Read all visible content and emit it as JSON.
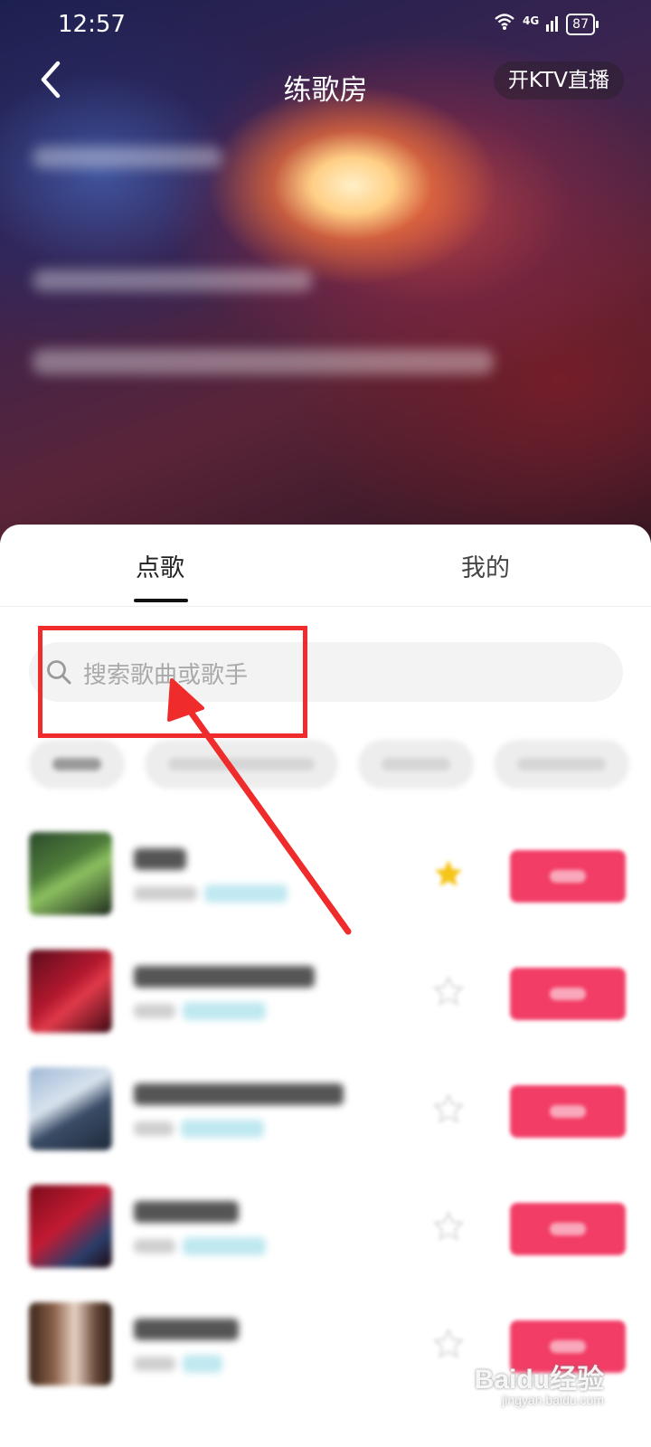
{
  "status_bar": {
    "time": "12:57",
    "network": "4G",
    "battery": "87"
  },
  "header": {
    "title": "练歌房",
    "ktv_button": "开KTV直播"
  },
  "tabs": [
    {
      "label": "点歌",
      "active": true
    },
    {
      "label": "我的",
      "active": false
    }
  ],
  "search": {
    "placeholder": "搜索歌曲或歌手"
  },
  "songs": [
    {
      "starred": true
    },
    {
      "starred": false
    },
    {
      "starred": false
    },
    {
      "starred": false
    },
    {
      "starred": false
    }
  ],
  "colors": {
    "accent": "#f23d66",
    "annotation": "#ef2b2b",
    "star": "#f5c518"
  },
  "watermark": {
    "brand": "Baidu经验",
    "url": "jingyan.baidu.com"
  }
}
